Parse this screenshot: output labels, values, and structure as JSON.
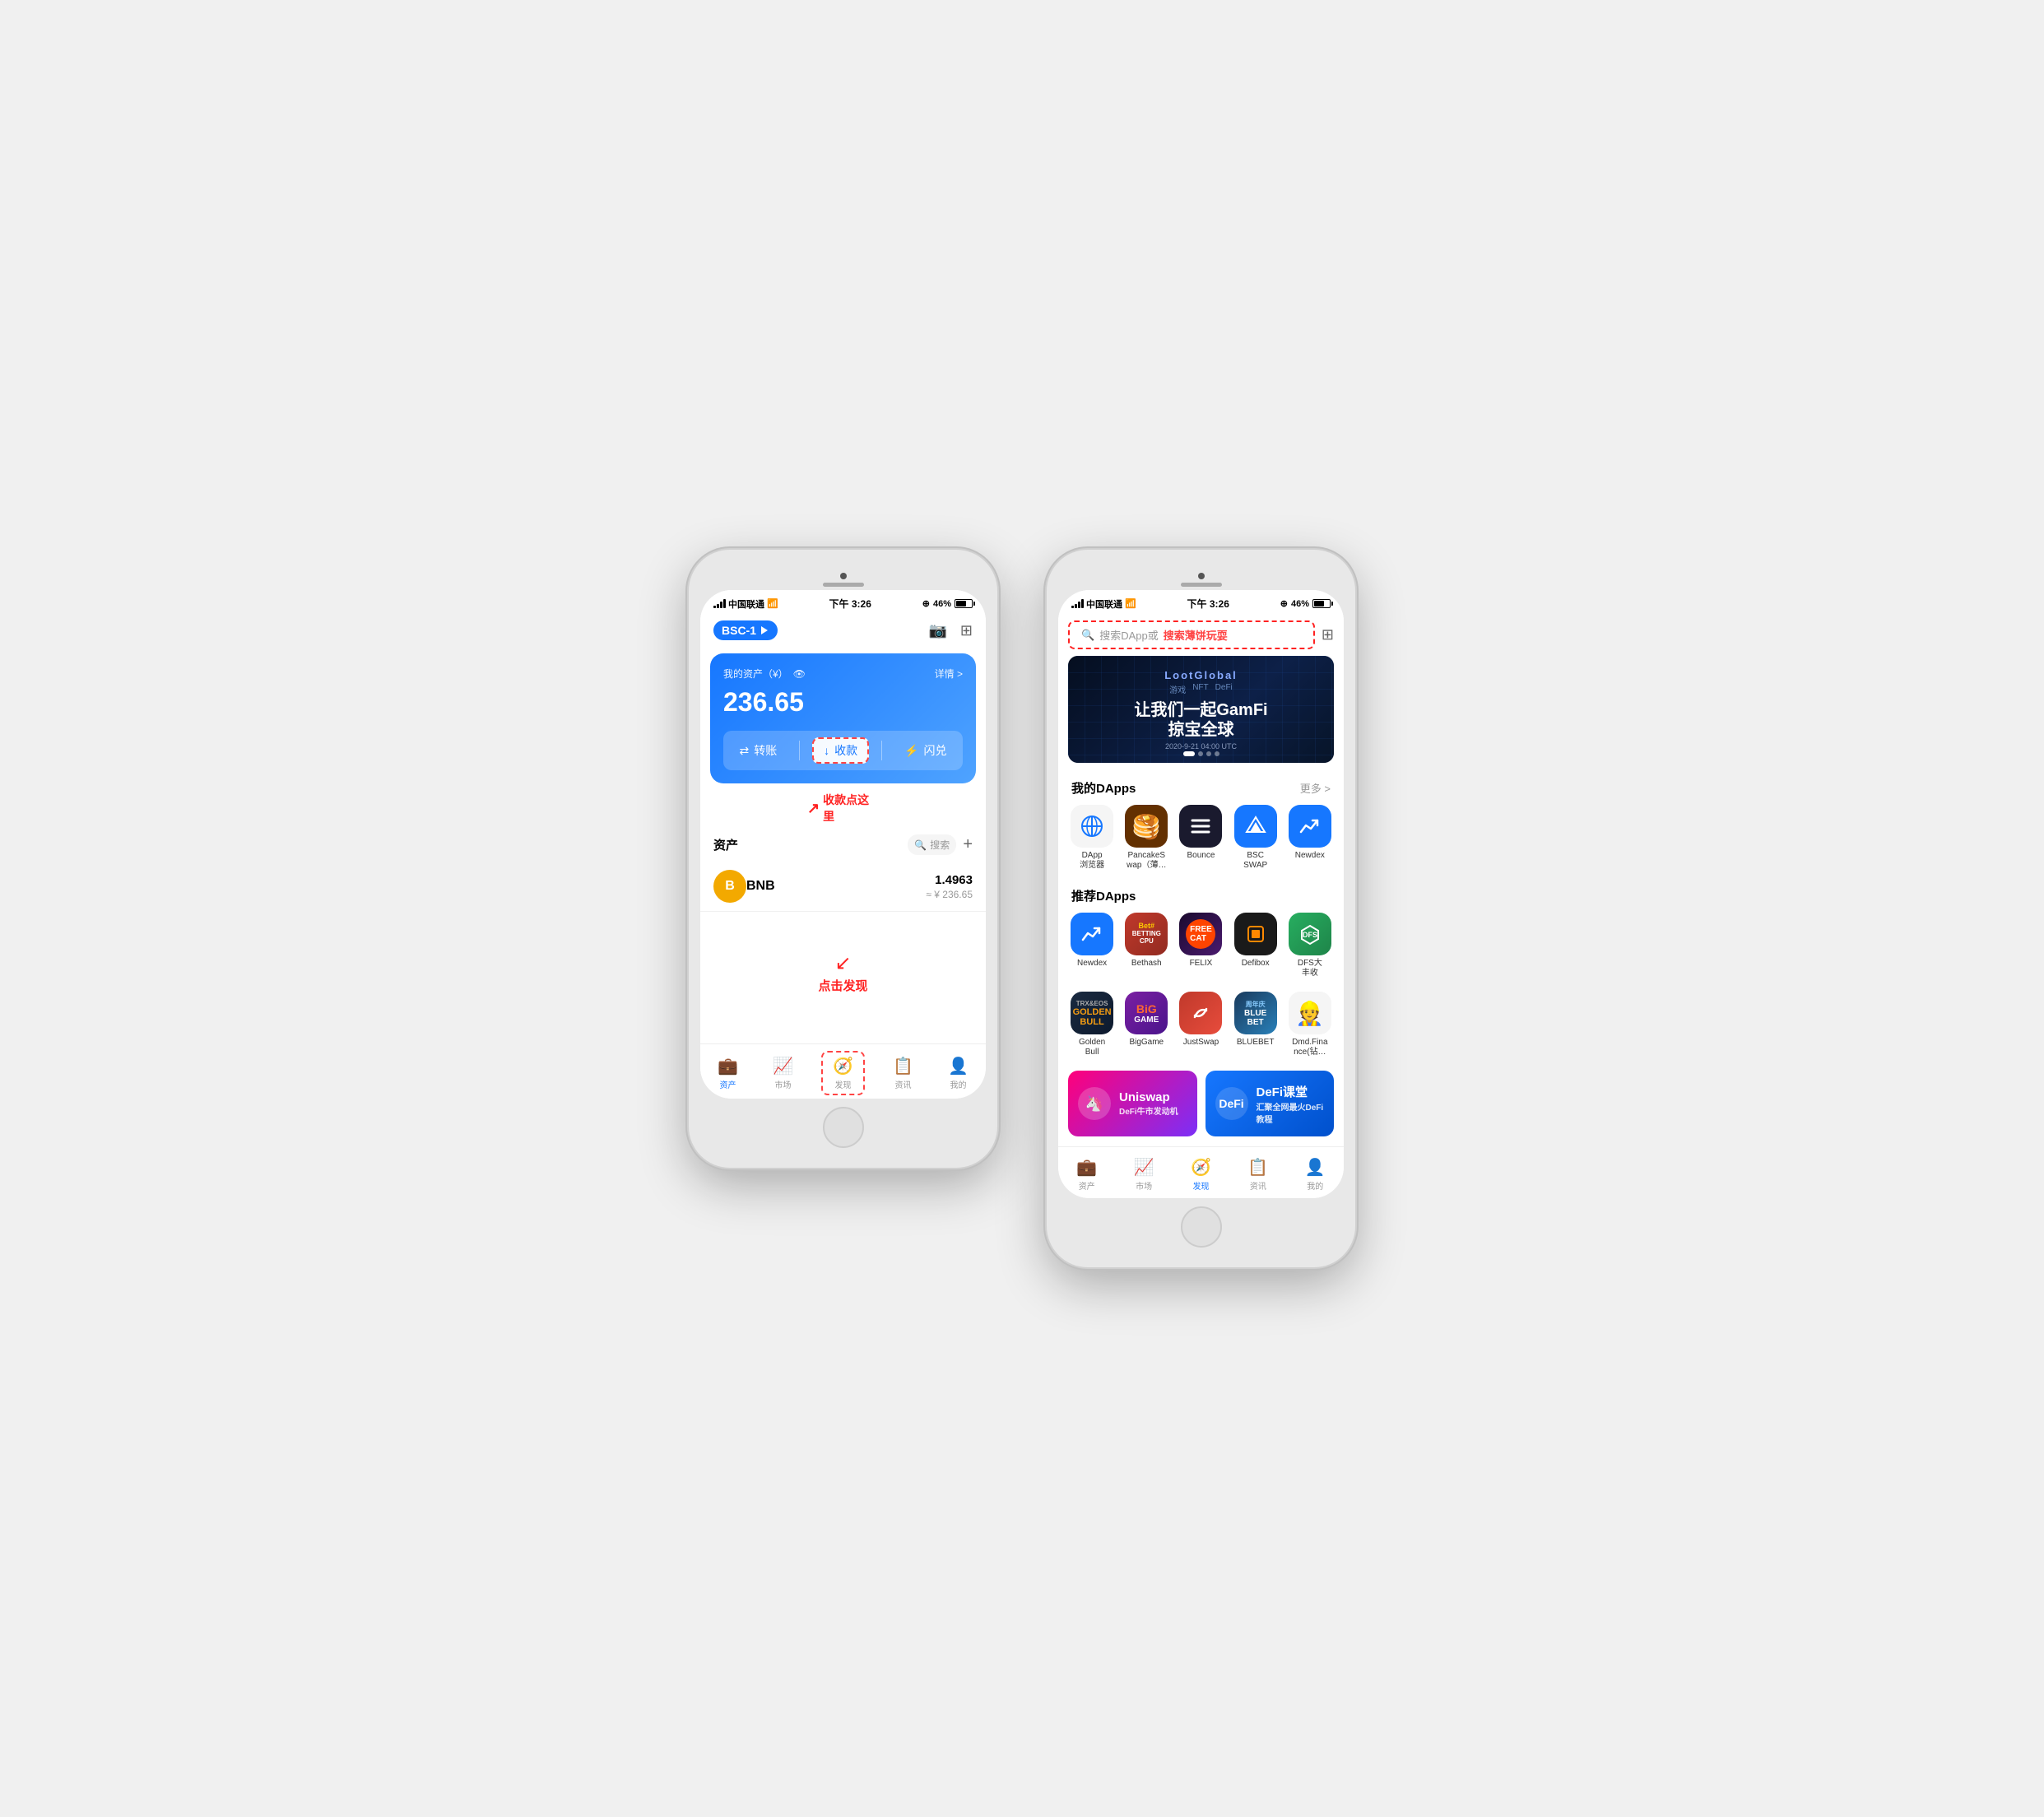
{
  "page": {
    "background_color": "#f0f0f0"
  },
  "left_phone": {
    "status_bar": {
      "carrier": "中国联通",
      "time": "下午 3:26",
      "battery": "46%"
    },
    "header": {
      "network_badge": "BSC-1"
    },
    "asset_card": {
      "label": "我的资产（¥）",
      "detail": "详情 >",
      "amount": "236.65",
      "actions": {
        "transfer": "转账",
        "receive": "收款",
        "flash": "闪兑"
      }
    },
    "annotation_receive": "收款点这里",
    "asset_list": {
      "title": "资产",
      "search_placeholder": "搜索",
      "items": [
        {
          "name": "BNB",
          "amount": "1.4963",
          "value": "≈ ¥ 236.65"
        }
      ]
    },
    "annotation_discover": "点击发现",
    "bottom_nav": {
      "items": [
        {
          "label": "资产",
          "active": false
        },
        {
          "label": "市场",
          "active": false
        },
        {
          "label": "发现",
          "active": false
        },
        {
          "label": "资讯",
          "active": false
        },
        {
          "label": "我的",
          "active": false
        }
      ]
    }
  },
  "right_phone": {
    "status_bar": {
      "carrier": "中国联通",
      "time": "下午 3:26",
      "battery": "46%"
    },
    "search": {
      "placeholder": "搜索DApp或",
      "highlight_text": "搜索薄饼玩耍"
    },
    "banner": {
      "logo": "LootGlobal",
      "tags": [
        "游戏",
        "NFT",
        "DeFi"
      ],
      "date": "2020-9-21  04:00 UTC",
      "title_line1": "让我们一起GamFi",
      "title_line2": "掠宝全球"
    },
    "my_dapps": {
      "section_title": "我的DApps",
      "more_label": "更多 >",
      "items": [
        {
          "name": "DApp\n浏览器",
          "icon_type": "browser"
        },
        {
          "name": "PancakeS\nwap（薄…",
          "icon_type": "pancake"
        },
        {
          "name": "Bounce",
          "icon_type": "bounce"
        },
        {
          "name": "BSC\nSWAP",
          "icon_type": "bscswap"
        },
        {
          "name": "Newdex",
          "icon_type": "newdex"
        }
      ]
    },
    "recommended_dapps": {
      "section_title": "推荐DApps",
      "rows": [
        [
          {
            "name": "Newdex",
            "icon_type": "newdex2"
          },
          {
            "name": "Bethash",
            "icon_type": "bethash"
          },
          {
            "name": "FELIX",
            "icon_type": "felix"
          },
          {
            "name": "Defibox",
            "icon_type": "defibox"
          },
          {
            "name": "DFS大\n丰收",
            "icon_type": "dfs"
          }
        ],
        [
          {
            "name": "Golden\nBull",
            "icon_type": "goldenbull"
          },
          {
            "name": "BigGame",
            "icon_type": "biggame"
          },
          {
            "name": "JustSwap",
            "icon_type": "justswap"
          },
          {
            "name": "BLUEBET",
            "icon_type": "bluebet"
          },
          {
            "name": "Dmd.Fina\nnce(钻…",
            "icon_type": "dmd"
          }
        ]
      ]
    },
    "promo": {
      "uniswap": {
        "name": "Uniswap",
        "desc": "DeFi牛市发动机"
      },
      "defi": {
        "name": "DeFi课堂",
        "desc": "汇聚全网最火DeFi教程"
      }
    },
    "bottom_nav": {
      "items": [
        {
          "label": "资产",
          "active": false
        },
        {
          "label": "市场",
          "active": false
        },
        {
          "label": "发现",
          "active": true
        },
        {
          "label": "资讯",
          "active": false
        },
        {
          "label": "我的",
          "active": false
        }
      ]
    }
  }
}
